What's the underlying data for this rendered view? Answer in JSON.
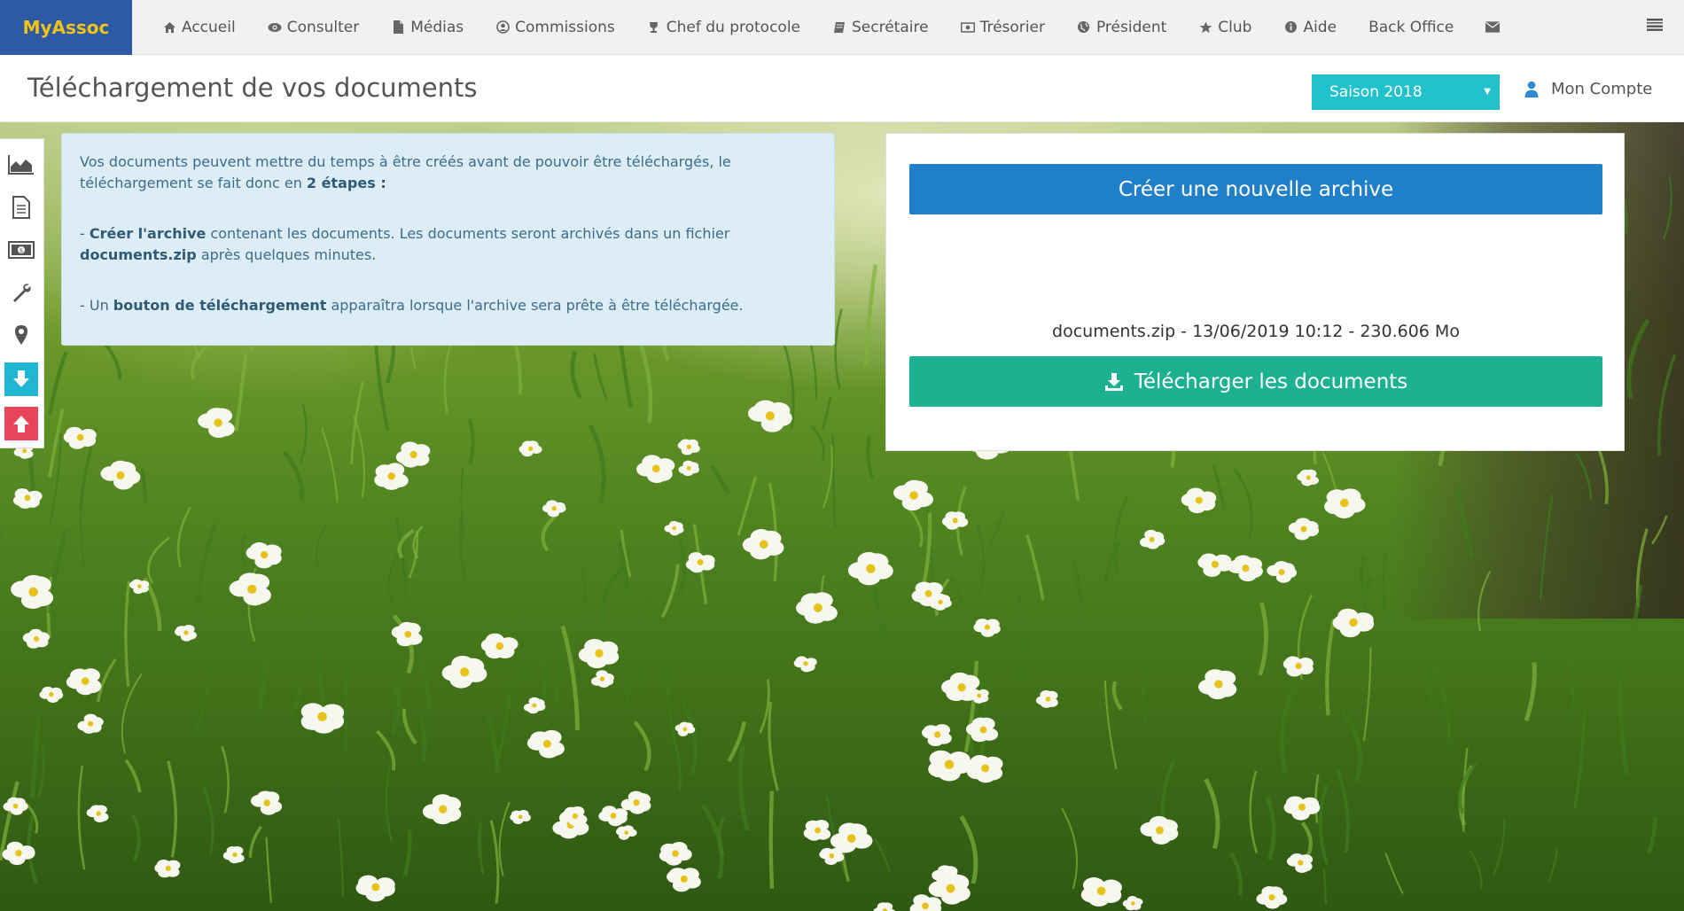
{
  "brand": "MyAssoc",
  "nav": [
    {
      "label": "Accueil",
      "icon": "home-icon"
    },
    {
      "label": "Consulter",
      "icon": "eye-icon"
    },
    {
      "label": "Médias",
      "icon": "file-icon"
    },
    {
      "label": "Commissions",
      "icon": "user-circle-icon"
    },
    {
      "label": "Chef du protocole",
      "icon": "trophy-icon"
    },
    {
      "label": "Secrétaire",
      "icon": "book-icon"
    },
    {
      "label": "Trésorier",
      "icon": "money-icon"
    },
    {
      "label": "Président",
      "icon": "globe-icon"
    },
    {
      "label": "Club",
      "icon": "star-icon"
    },
    {
      "label": "Aide",
      "icon": "info-icon"
    },
    {
      "label": "Back Office",
      "icon": ""
    }
  ],
  "page_title": "Téléchargement de vos documents",
  "season": "Saison 2018",
  "account": "Mon Compte",
  "info": {
    "p1_text": "Vos documents peuvent mettre du temps à être créés avant de pouvoir être téléchargés, le téléchargement se fait donc en ",
    "p1_bold": "2 étapes :",
    "p2_prefix": "- ",
    "p2_bold1": "Créer l'archive",
    "p2_text": " contenant les documents. Les documents seront archivés dans un fichier ",
    "p2_bold2": "documents.zip",
    "p2_suffix": " après quelques minutes.",
    "p3_prefix": "- Un ",
    "p3_bold": "bouton de téléchargement",
    "p3_suffix": " apparaîtra lorsque l'archive sera prête à être téléchargée."
  },
  "panel": {
    "create_label": "Créer une nouvelle archive",
    "file_info": "documents.zip - 13/06/2019 10:12 - 230.606 Mo",
    "download_label": "Télécharger les documents"
  },
  "colors": {
    "brand_bg": "#2e5aa5",
    "brand_fg": "#f3c316",
    "season_bg": "#21c2cc",
    "create_btn": "#1f7fc8",
    "download_btn": "#1bb191",
    "info_bg": "#dcedf5"
  }
}
